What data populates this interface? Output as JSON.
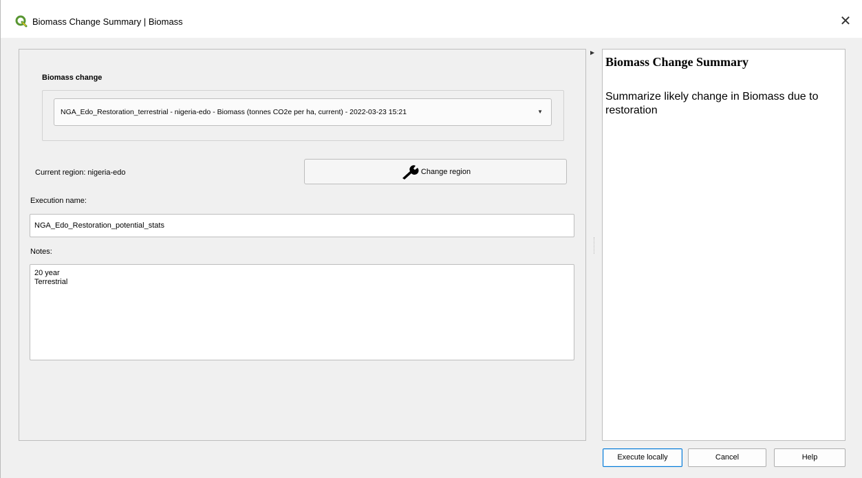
{
  "window": {
    "title": "Biomass Change Summary | Biomass",
    "app_icon": "qgis-icon",
    "close_glyph": "✕"
  },
  "form": {
    "group_label": "Biomass change",
    "combo_value": "NGA_Edo_Restoration_terrestrial - nigeria-edo - Biomass (tonnes CO2e per ha, current) - 2022-03-23 15:21",
    "combo_arrow": "▼",
    "region_label": "Current region: nigeria-edo",
    "change_region_label": "Change region",
    "change_region_icon": "wrench-icon",
    "execution_name_label": "Execution name:",
    "execution_name_value": "NGA_Edo_Restoration_potential_stats",
    "notes_label": "Notes:",
    "notes_value": "20 year\nTerrestrial"
  },
  "help": {
    "title": "Biomass Change Summary",
    "text": "Summarize likely change in Biomass due to restoration",
    "expand_arrow": "▶"
  },
  "buttons": {
    "execute": "Execute locally",
    "cancel": "Cancel",
    "help": "Help"
  },
  "colors": {
    "accent": "#0078d7",
    "qgis_green": "#589632",
    "qgis_yellow": "#eec81a"
  }
}
